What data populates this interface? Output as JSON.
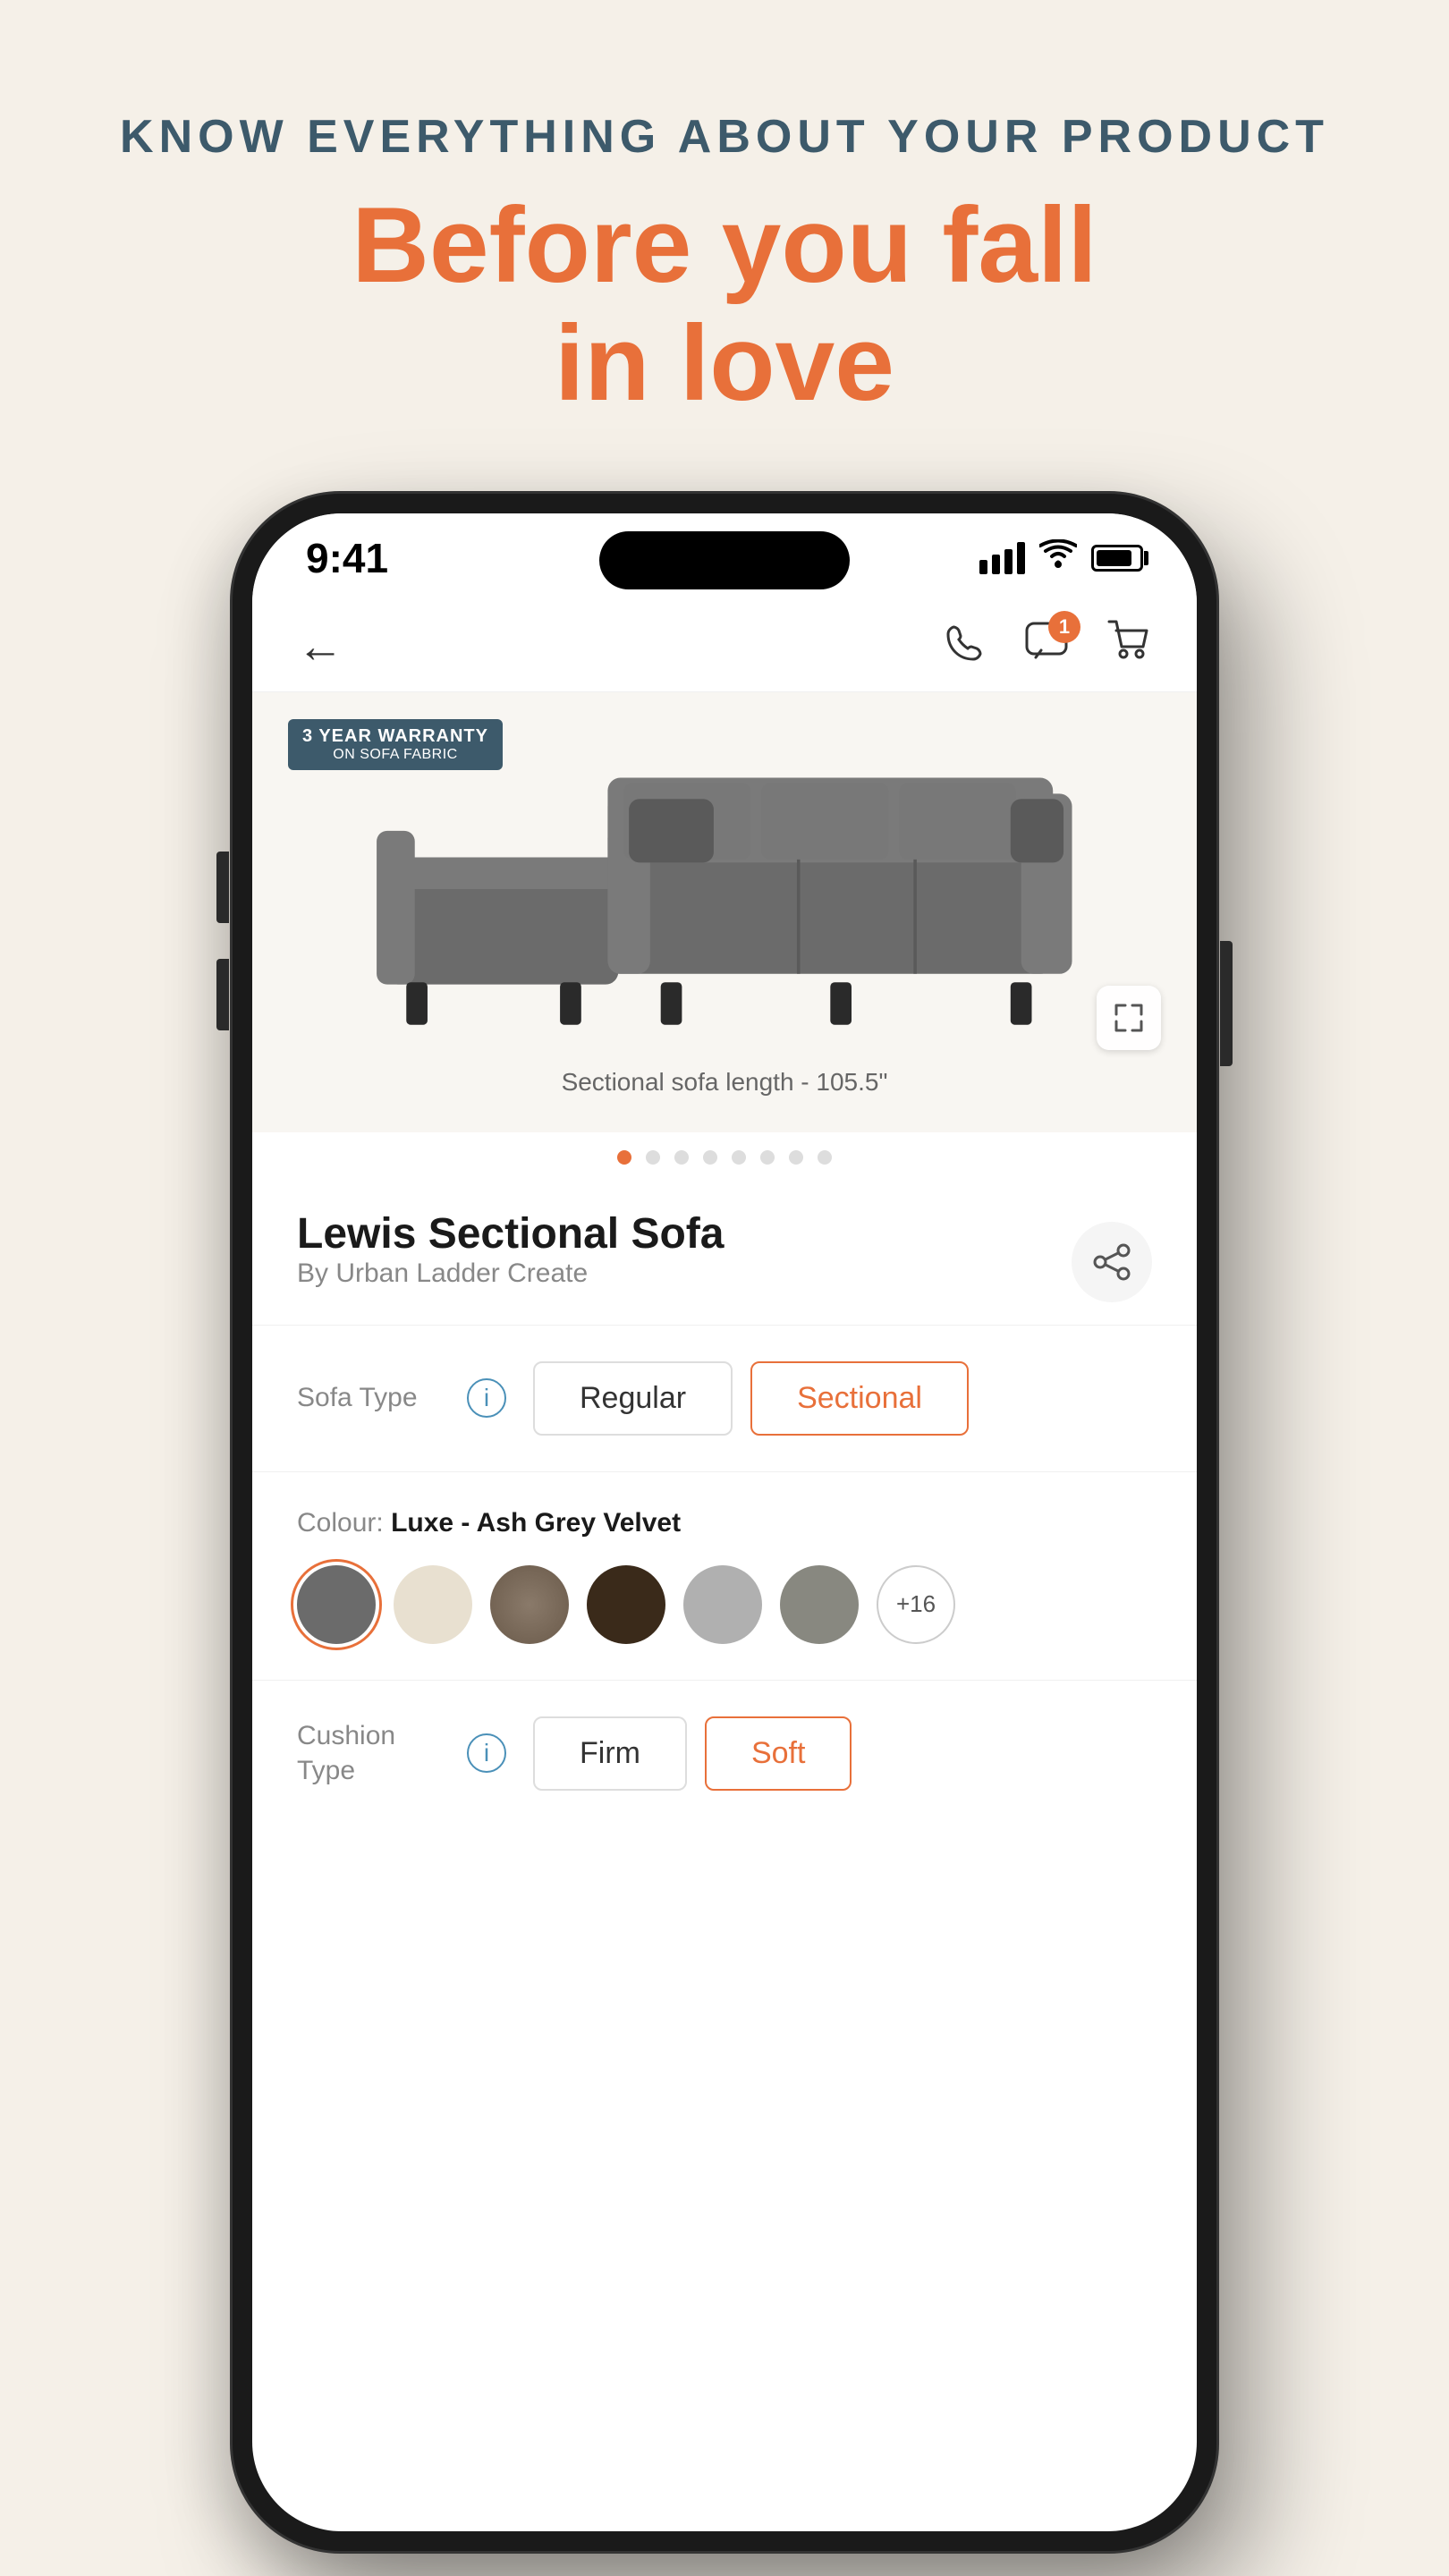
{
  "header": {
    "subtitle": "KNOW EVERYTHING ABOUT YOUR PRODUCT",
    "main_title": "Before you fall\nin love"
  },
  "status_bar": {
    "time": "9:41",
    "signal": "signal",
    "wifi": "wifi",
    "battery": "battery"
  },
  "nav": {
    "back_label": "←",
    "phone_icon": "phone",
    "chat_icon": "chat",
    "cart_icon": "cart",
    "badge_count": "1"
  },
  "product": {
    "warranty_badge_line1": "3 YEAR WARRANTY",
    "warranty_badge_line2": "ON SOFA FABRIC",
    "image_caption": "Sectional sofa length - 105.5\"",
    "title": "Lewis Sectional Sofa",
    "by": "By Urban Ladder Create"
  },
  "dots": {
    "total": 8,
    "active_index": 0
  },
  "sofa_type": {
    "label": "Sofa Type",
    "options": [
      {
        "id": "regular",
        "label": "Regular",
        "selected": false
      },
      {
        "id": "sectional",
        "label": "Sectional",
        "selected": true
      }
    ]
  },
  "colour": {
    "label": "Colour:",
    "value": "Luxe - Ash Grey Velvet",
    "swatches": [
      {
        "id": "ash-grey",
        "color": "#6b6b6b",
        "selected": true
      },
      {
        "id": "cream",
        "color": "#e8e0d0",
        "selected": false
      },
      {
        "id": "brown-weave",
        "color": "#7a6a5a",
        "selected": false
      },
      {
        "id": "dark-brown",
        "color": "#3a2a1a",
        "selected": false
      },
      {
        "id": "light-grey",
        "color": "#b0b0b0",
        "selected": false
      },
      {
        "id": "dark-grey",
        "color": "#888880",
        "selected": false
      }
    ],
    "more_count": "+16"
  },
  "cushion_type": {
    "label": "Cushion\nType",
    "options": [
      {
        "id": "firm",
        "label": "Firm",
        "selected": false
      },
      {
        "id": "soft",
        "label": "Soft",
        "selected": true
      }
    ]
  },
  "icons": {
    "back": "←",
    "phone": "☎",
    "chat": "💬",
    "cart": "🛒",
    "share": "↗",
    "expand": "⤢",
    "info": "i"
  }
}
